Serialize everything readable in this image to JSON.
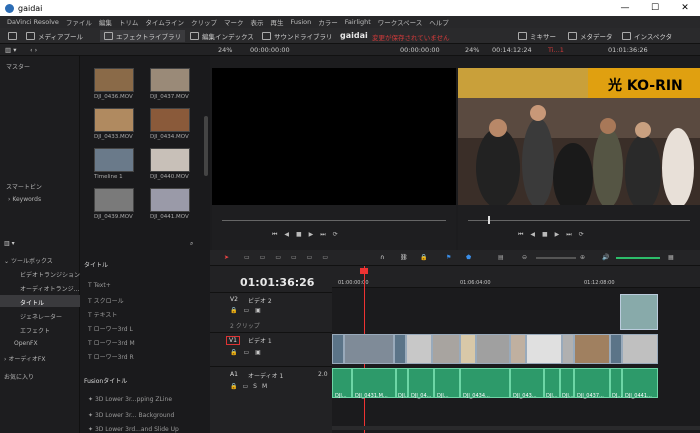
{
  "window": {
    "title": "gaidai"
  },
  "menu": [
    "DaVinci Resolve",
    "ファイル",
    "編集",
    "トリム",
    "タイムライン",
    "クリップ",
    "マーク",
    "表示",
    "再生",
    "Fusion",
    "カラー",
    "Fairlight",
    "ワークスペース",
    "ヘルプ"
  ],
  "toolbar": {
    "media_pool": "メディアプール",
    "effects_library": "エフェクトライブラリ",
    "edit_index": "編集インデックス",
    "sound_library": "サウンドライブラリ",
    "project_name": "gaidai",
    "unsaved": "変更が保存されていません",
    "mixer": "ミキサー",
    "metadata": "メタデータ",
    "inspector": "インスペクタ"
  },
  "subbar": {
    "source_zoom": "24%",
    "source_tc": "00:00:00:00",
    "source_dur": "00:00:00:00",
    "timeline_zoom": "24%",
    "timeline_dur": "00:14:12:24",
    "timeline_name": "Ti...1",
    "timeline_tc": "01:01:36:26"
  },
  "bins": {
    "master": "マスター",
    "smart_bins": "スマートビン",
    "keywords": "Keywords"
  },
  "clips": [
    {
      "name": "DJI_0436.MOV",
      "color": "#8a6a48"
    },
    {
      "name": "DJI_0437.MOV",
      "color": "#9a8a78"
    },
    {
      "name": "DJI_0433.MOV",
      "color": "#b08a60"
    },
    {
      "name": "DJI_0434.MOV",
      "color": "#8a5a3a"
    },
    {
      "name": "Timeline 1",
      "color": "#6a7a8a"
    },
    {
      "name": "DJI_0440.MOV",
      "color": "#c8c0b8"
    },
    {
      "name": "DJI_0439.MOV",
      "color": "#7a7a7a"
    },
    {
      "name": "DJI_0441.MOV",
      "color": "#9a9aa8"
    }
  ],
  "toolbox": {
    "header": "ツールボックス",
    "items": [
      "ビデオトランジション",
      "オーディオトランジ...",
      "タイトル",
      "ジェネレーター",
      "エフェクト",
      "OpenFX",
      "オーディオFX"
    ],
    "favorites": "お気に入り"
  },
  "titles": {
    "header": "タイトル",
    "items": [
      "Text+",
      "スクロール",
      "テキスト",
      "ローワー3rd L",
      "ローワー3rd M",
      "ローワー3rd R"
    ],
    "fusion_header": "Fusionタイトル",
    "fusion_items": [
      "3D Lower 3r...pping ZLine",
      "3D Lower 3r... Background",
      "3D Lower 3rd...and Slide Up"
    ]
  },
  "timeline": {
    "timecode": "01:01:36:26",
    "ruler": [
      "01:00:00:00",
      "01:06:04:00",
      "01:12:08:00"
    ],
    "tracks": [
      {
        "id": "V2",
        "name": "ビデオ 2",
        "info": "2 クリップ"
      },
      {
        "id": "V1",
        "name": "ビデオ 1",
        "info": ""
      },
      {
        "id": "A1",
        "name": "オーディオ 1",
        "info": "2.0"
      }
    ],
    "audio_clip_labels": [
      "DJI...",
      "DJI_0431.M...",
      "DJI...",
      "DJI_04...",
      "DJI...",
      "DJI_0434...",
      "DJI_043...",
      "DJI...",
      "DJI...",
      "DJI_0437...",
      "DJ...",
      "DJI_0441..."
    ]
  }
}
